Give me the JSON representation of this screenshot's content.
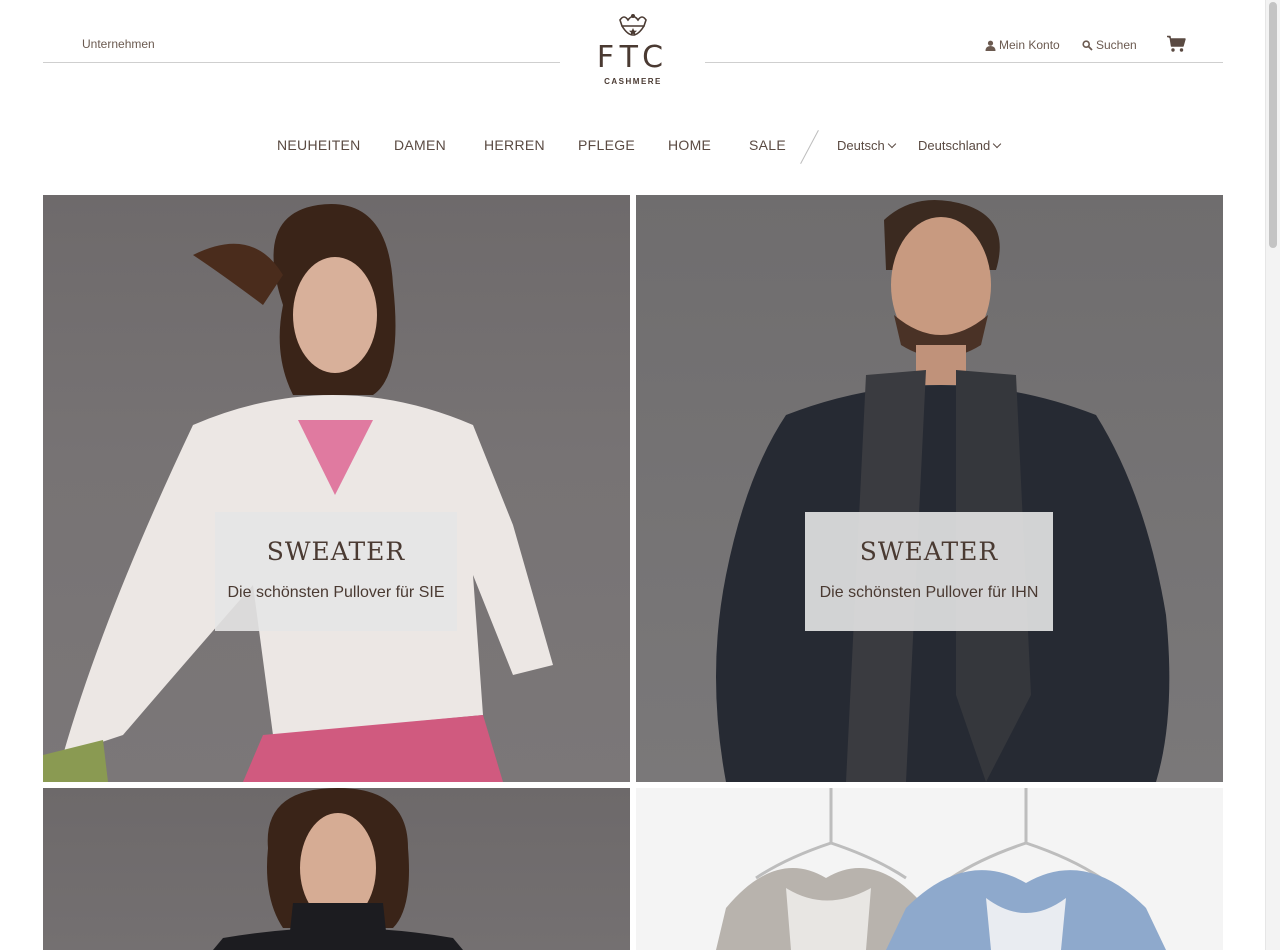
{
  "header": {
    "company_link": "Unternehmen",
    "logo_text": "FTC",
    "logo_subtext": "CASHMERE",
    "account_label": "Mein Konto",
    "search_label": "Suchen"
  },
  "nav": {
    "items": [
      "NEUHEITEN",
      "DAMEN",
      "HERREN",
      "PFLEGE",
      "HOME",
      "SALE"
    ],
    "language": "Deutsch",
    "country": "Deutschland"
  },
  "tiles": [
    {
      "title": "SWEATER",
      "subtitle": "Die schönsten Pullover für SIE"
    },
    {
      "title": "SWEATER",
      "subtitle": "Die schönsten Pullover für IHN"
    }
  ],
  "colors": {
    "text": "#5a4a42",
    "rule": "#cfcfcf",
    "caption_bg": "#e6e5e5",
    "photo_bg": "#747071"
  }
}
